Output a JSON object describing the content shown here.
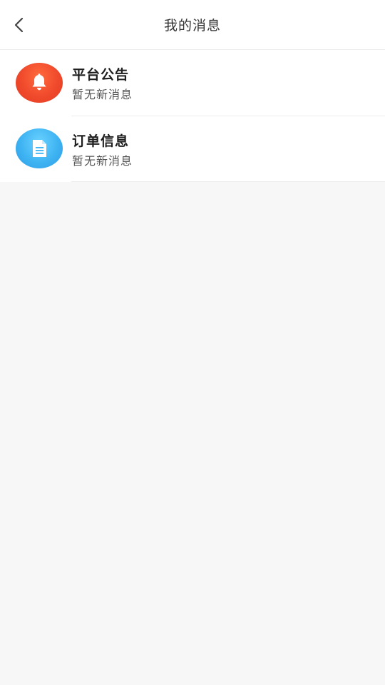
{
  "header": {
    "title": "我的消息",
    "back_icon": "chevron-left-icon"
  },
  "messages": [
    {
      "title": "平台公告",
      "subtitle": "暂无新消息",
      "icon": "bell-icon",
      "icon_color": "#f04a2c"
    },
    {
      "title": "订单信息",
      "subtitle": "暂无新消息",
      "icon": "document-icon",
      "icon_color": "#3fb4f2"
    }
  ],
  "colors": {
    "page_background": "#f7f7f7",
    "header_background": "#ffffff",
    "divider": "#ececec"
  }
}
